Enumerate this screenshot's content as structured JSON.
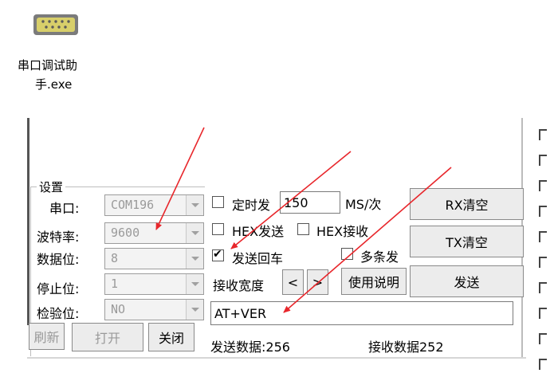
{
  "desktop_icon": {
    "label_line1": "串口调试助",
    "label_line2": "手.exe",
    "icon": "serial-port-icon"
  },
  "settings": {
    "frame_title": "设置",
    "port": {
      "label": "串口:",
      "value": "COM196"
    },
    "baud": {
      "label": "波特率:",
      "value": "9600"
    },
    "data_bits": {
      "label": "数据位:",
      "value": "8"
    },
    "stop_bits": {
      "label": "停止位:",
      "value": "1"
    },
    "parity": {
      "label": "检验位:",
      "value": "NO"
    }
  },
  "buttons": {
    "refresh": "刷新",
    "open": "打开",
    "close": "关闭",
    "rx_clear": "RX清空",
    "tx_clear": "TX清空",
    "send": "发送",
    "help": "使用说明",
    "width_left": "<",
    "width_right": ">"
  },
  "options": {
    "timed_send": {
      "label": "定时发",
      "checked": false
    },
    "interval": {
      "value": "150",
      "unit": "MS/次"
    },
    "hex_send": {
      "label": "HEX发送",
      "checked": false
    },
    "hex_recv": {
      "label": "HEX接收",
      "checked": false
    },
    "send_crlf": {
      "label": "发送回车",
      "checked": true
    },
    "multi_send": {
      "label": "多条发",
      "checked": false
    },
    "recv_width": {
      "label": "接收宽度"
    }
  },
  "send_input": {
    "value": "AT+VER"
  },
  "stats": {
    "sent": "发送数据:256",
    "received": "接收数据252"
  },
  "colors": {
    "annotation_arrow": "#e8262b",
    "disabled_text": "#9a9a9a"
  }
}
